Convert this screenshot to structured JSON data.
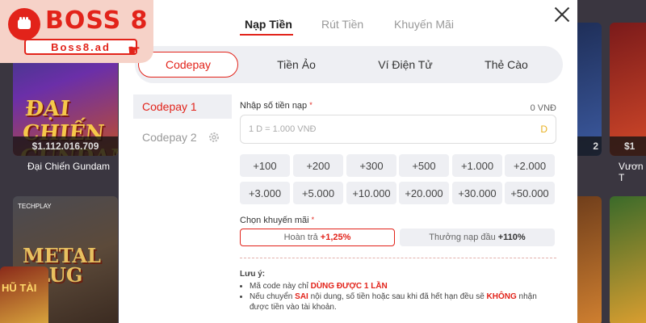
{
  "background_games": [
    {
      "title_art": "ĐẠI CHIẾN GUNDAM",
      "price": "$1.112.016.709",
      "name": "Đại Chiến Gundam"
    },
    {
      "title_art": "METAL SLUG",
      "publisher": "TECHPLAY"
    },
    {
      "price": "$1",
      "name": "Vươn T"
    },
    {
      "price": "2"
    },
    {
      "title_art": "HŨ TÀI"
    }
  ],
  "logo": {
    "brand": "BOSS 8",
    "domain": "Boss8.ad"
  },
  "modal": {
    "tabs": [
      "Nạp Tiền",
      "Rút Tiền",
      "Khuyến Mãi"
    ],
    "active_tab": "Nạp Tiền",
    "methods": [
      "Codepay",
      "Tiền Ảo",
      "Ví Điện Tử",
      "Thẻ Cào"
    ],
    "active_method": "Codepay",
    "sidebar": [
      "Codepay 1",
      "Codepay 2"
    ],
    "active_sidebar": "Codepay 1",
    "amount_label": "Nhập số tiền nạp",
    "amount_value": "0 VNĐ",
    "amount_placeholder": "1 D = 1.000 VNĐ",
    "amount_currency_symbol": "D",
    "quick_amounts": [
      "+100",
      "+200",
      "+300",
      "+500",
      "+1.000",
      "+2.000",
      "+3.000",
      "+5.000",
      "+10.000",
      "+20.000",
      "+30.000",
      "+50.000"
    ],
    "promo_label": "Chọn khuyến mãi",
    "promos": [
      {
        "text": "Hoàn trả",
        "value": "+1,25%"
      },
      {
        "text": "Thưởng nạp đầu",
        "value": "+110%"
      }
    ],
    "note": {
      "title": "Lưu ý:",
      "line1_pre": "Mã code này chỉ ",
      "line1_em": "DÙNG ĐƯỢC 1 LẦN",
      "line2_pre": "Nếu chuyển ",
      "line2_em1": "SAI",
      "line2_mid": " nội dung, số tiền hoặc sau khi đã hết hạn đều sẽ ",
      "line2_em2": "KHÔNG",
      "line2_post": " nhận được tiền vào tài khoản."
    }
  },
  "colors": {
    "accent": "#e2231a",
    "chip_bg": "#eeeff3"
  }
}
